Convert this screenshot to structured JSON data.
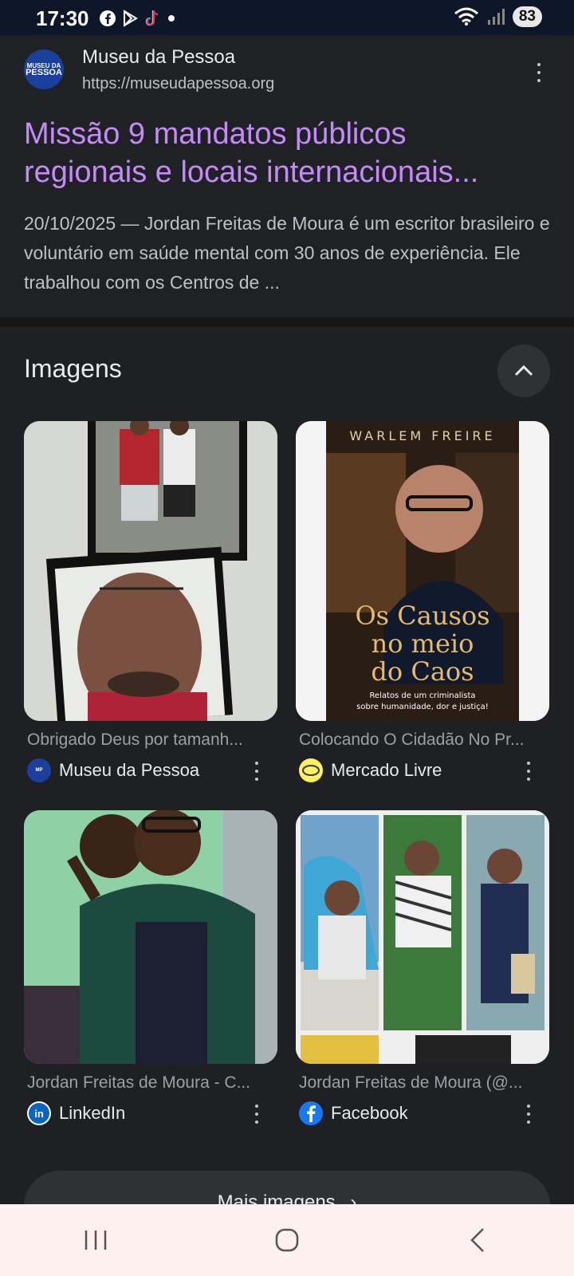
{
  "status_bar": {
    "time": "17:30",
    "battery": "83",
    "notification_icons": [
      "facebook-icon",
      "play-store-icon",
      "tiktok-icon",
      "dot-icon"
    ]
  },
  "result": {
    "site_name": "Museu da Pessoa",
    "site_url": "https://museudapessoa.org",
    "logo_text_top": "MUSEU DA",
    "logo_text_bottom": "PESSOA",
    "title_line1": "Missão 9 mandatos públicos",
    "title_line2": "regionais e locais internacionais...",
    "snippet": "20/10/2025 — Jordan Freitas de Moura é um escritor brasileiro e voluntário em saúde mental com 30 anos de experiência. Ele trabalhou com os Centros de ..."
  },
  "images": {
    "title": "Imagens",
    "cards": [
      {
        "caption": "Obrigado Deus por tamanh...",
        "source": "Museu da Pessoa",
        "icon": "museu-logo-icon"
      },
      {
        "caption": "Colocando O Cidadão No Pr...",
        "source": "Mercado Livre",
        "icon": "mercado-livre-icon",
        "cover_author": "WARLEM FREIRE",
        "cover_title_1": "Os Causos",
        "cover_title_2": "no meio",
        "cover_title_3": "do Caos",
        "cover_sub_1": "Relatos de um criminalista",
        "cover_sub_2": "sobre humanidade, dor e justiça!"
      },
      {
        "caption": "Jordan Freitas de Moura - C...",
        "source": "LinkedIn",
        "icon": "linkedin-icon"
      },
      {
        "caption": "Jordan Freitas de Moura (@...",
        "source": "Facebook",
        "icon": "facebook-icon"
      }
    ],
    "more_label": "Mais imagens"
  },
  "colors": {
    "title_link": "#c58af9",
    "background": "#1f2023",
    "nav_bar": "#fcf1ee"
  }
}
